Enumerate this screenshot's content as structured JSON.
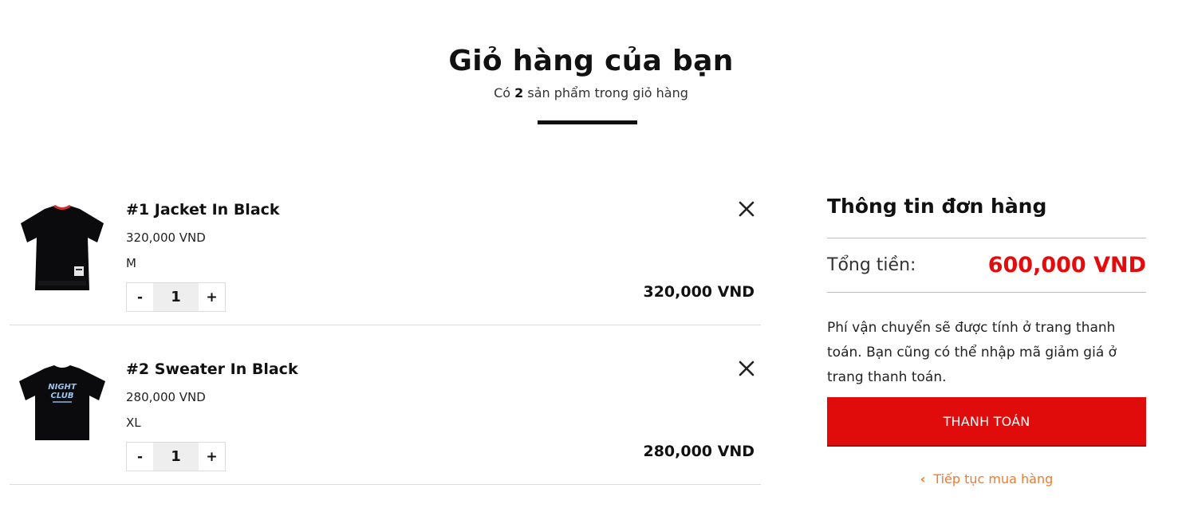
{
  "header": {
    "title": "Giỏ hàng của bạn",
    "subtitle_prefix": "Có ",
    "subtitle_count": "2",
    "subtitle_suffix": " sản phẩm trong giỏ hàng"
  },
  "cart": {
    "items": [
      {
        "name": "#1 Jacket In Black",
        "unit_price": "320,000 VND",
        "variant": "M",
        "minus_label": "-",
        "quantity": "1",
        "plus_label": "+",
        "line_total": "320,000 VND",
        "image_icon": "black-tshirt-image"
      },
      {
        "name": "#2 Sweater In Black",
        "unit_price": "280,000 VND",
        "variant": "XL",
        "minus_label": "-",
        "quantity": "1",
        "plus_label": "+",
        "line_total": "280,000 VND",
        "image_icon": "night-club-tshirt-image",
        "print_line1": "NIGHT",
        "print_line2": "CLUB"
      }
    ]
  },
  "summary": {
    "title": "Thông tin đơn hàng",
    "total_label": "Tổng tiền:",
    "total_value": "600,000 VND",
    "note": "Phí vận chuyển sẽ được tính ở trang thanh toán. Bạn cũng có thể nhập mã giảm giá ở trang thanh toán.",
    "checkout_label": "THANH TOÁN",
    "continue_label": "Tiếp tục mua hàng"
  },
  "colors": {
    "accent_red": "#e00c0c",
    "link_orange": "#f07a2d",
    "text_dark": "#111111"
  }
}
